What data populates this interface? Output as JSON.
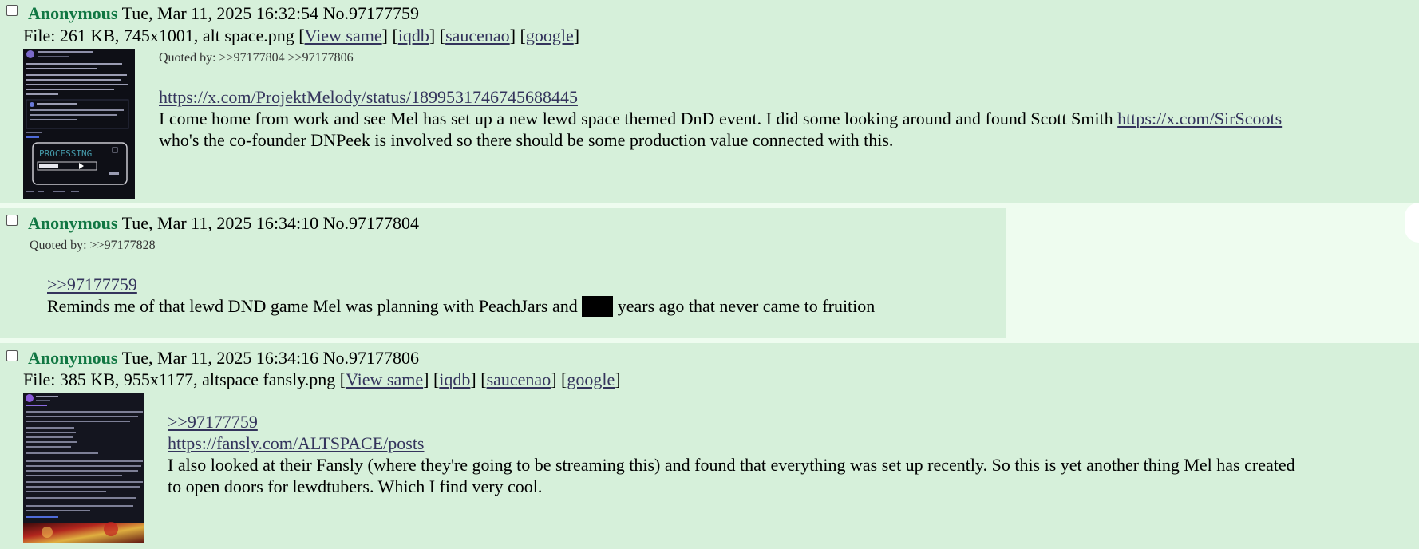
{
  "posts": [
    {
      "name": "Anonymous",
      "datetime": "Tue, Mar 11, 2025 16:32:54",
      "no_label": "No.",
      "no": "97177759",
      "file": {
        "prefix": "File: 261 KB, 745x1001, alt space.png [",
        "view_same": "View same",
        "sep1": "] [",
        "iqdb": "iqdb",
        "sep2": "] [",
        "saucenao": "saucenao",
        "sep3": "] [",
        "google": "google",
        "suffix": "]"
      },
      "quoted_by_label": "Quoted by: ",
      "quoted_by": [
        ">>97177804",
        ">>97177806"
      ],
      "link1": "https://x.com/ProjektMelody/status/1899531746745688445",
      "text_a": "I come home from work and see Mel has set up a new lewd space themed DnD event. I did some looking around and found Scott Smith ",
      "link2": "https://x.com/SirScoots",
      "text_b": "who's the co-founder DNPeek is involved so there should be some production value connected with this."
    },
    {
      "name": "Anonymous",
      "datetime": "Tue, Mar 11, 2025 16:34:10",
      "no_label": "No.",
      "no": "97177804",
      "quoted_by_label": "Quoted by: ",
      "quoted_by": [
        ">>97177828"
      ],
      "quote_link": ">>97177759",
      "text_a": "Reminds me of that lewd DND game Mel was planning with PeachJars and ",
      "text_b": " years ago that never came to fruition"
    },
    {
      "name": "Anonymous",
      "datetime": "Tue, Mar 11, 2025 16:34:16",
      "no_label": "No.",
      "no": "97177806",
      "file": {
        "prefix": "File: 385 KB, 955x1177, altspace fansly.png [",
        "view_same": "View same",
        "sep1": "] [",
        "iqdb": "iqdb",
        "sep2": "] [",
        "saucenao": "saucenao",
        "sep3": "] [",
        "google": "google",
        "suffix": "]"
      },
      "quote_link": ">>97177759",
      "link1": "https://fansly.com/ALTSPACE/posts",
      "text_a": "I also looked at their Fansly (where they're going to be streaming this) and found that everything was set up recently. So this is yet another thing Mel has created",
      "text_b": "to open doors for lewdtubers. Which I find very cool."
    }
  ],
  "thumb1_text": {
    "processing": "PROCESSING"
  },
  "colors": {
    "name": "#117743",
    "link": "#34345c",
    "post_bg": "#d6f0da",
    "page_bg": "#eefcef"
  }
}
